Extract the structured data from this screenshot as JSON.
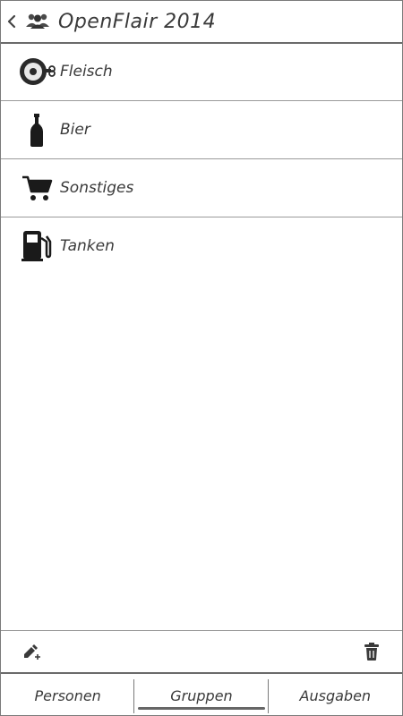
{
  "header": {
    "title": "OpenFlair 2014",
    "back_icon": "chevron-left-icon",
    "group_icon": "people-group-icon"
  },
  "categories": [
    {
      "label": "Fleisch",
      "icon": "meat-icon"
    },
    {
      "label": "Bier",
      "icon": "bottle-icon"
    },
    {
      "label": "Sonstiges",
      "icon": "shopping-cart-icon"
    },
    {
      "label": "Tanken",
      "icon": "fuel-pump-icon"
    }
  ],
  "toolbar": {
    "add_icon": "pencil-add-icon",
    "delete_icon": "trash-icon"
  },
  "tabs": [
    {
      "label": "Personen",
      "active": false
    },
    {
      "label": "Gruppen",
      "active": true
    },
    {
      "label": "Ausgaben",
      "active": false
    }
  ],
  "colors": {
    "text": "#3a3a3a",
    "border": "#7a7a7a",
    "icon": "#1a1a1a"
  }
}
